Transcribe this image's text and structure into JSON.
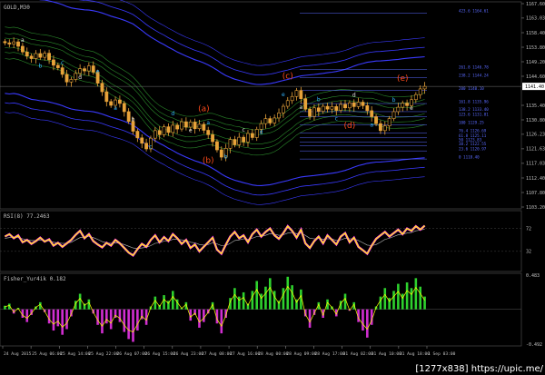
{
  "main_title": "GOLD,M30",
  "rsi_title": "RSI(8) 77.2463",
  "fisher_title": "Fisher_Yur4ik 0.182",
  "watermark": "[1277x838] https://upic.me/",
  "colors": {
    "background": "#000000",
    "candle": "#e8a33a",
    "envelope_blue": "#3a3aff",
    "envelope_green": "#2b8a2b",
    "fib_line": "#5a6aff",
    "wave_red": "#ff4a1a",
    "wave_cyan": "#33b5ff",
    "wave_white": "#e0e0e0",
    "rsi_yellow": "#ffff00",
    "rsi_magenta": "#ff33ff",
    "fisher_green": "#2ed12e",
    "fisher_magenta": "#d12ed1",
    "axis_text": "#c0c0c0"
  },
  "price_axis": {
    "ticks": [
      "1167.60",
      "1163.03",
      "1158.40",
      "1153.80",
      "1149.20",
      "1144.60",
      "1135.40",
      "1130.80",
      "1126.23",
      "1121.63",
      "1117.03",
      "1112.40",
      "1107.80",
      "1103.20"
    ],
    "current": "1141.40"
  },
  "rsi_axis": {
    "ticks": [
      "72",
      "32"
    ]
  },
  "fisher_axis": {
    "ticks": [
      "0.483",
      "-0.492"
    ]
  },
  "time_axis": [
    "24 Aug 2015",
    "25 Aug 06:00",
    "25 Aug 14:00",
    "25 Aug 22:00",
    "26 Aug 07:00",
    "26 Aug 15:00",
    "26 Aug 23:00",
    "27 Aug 08:00",
    "27 Aug 16:00",
    "28 Aug 00:00",
    "28 Aug 09:00",
    "28 Aug 17:00",
    "31 Aug 02:00",
    "31 Aug 10:00",
    "31 Aug 18:00",
    "1 Sep 03:00"
  ],
  "fib_levels": [
    {
      "label": "423.6 1164.61"
    },
    {
      "label": "261.8 1146.78"
    },
    {
      "label": "238.2 1144.24"
    },
    {
      "label": "200 1140.10"
    },
    {
      "label": "161.8 1135.96"
    },
    {
      "label": "138.2 1133.40"
    },
    {
      "label": "123.6 1131.81"
    },
    {
      "label": "100 1129.25"
    },
    {
      "label": "76.4 1126.69"
    },
    {
      "label": "61.8 1125.11"
    },
    {
      "label": "50 1123.83"
    },
    {
      "label": "38.2 1122.55"
    },
    {
      "label": "23.6 1120.97"
    },
    {
      "label": "0 1118.40"
    }
  ],
  "wave_labels_major": [
    "(a)",
    "(b)",
    "(c)",
    "(d)",
    "(e)"
  ],
  "wave_labels_minor": [
    "a",
    "b",
    "c",
    "d",
    "e",
    "a",
    "b",
    "c",
    "d",
    "e",
    "a",
    "b",
    "c",
    "d",
    "e",
    "a",
    "b",
    "c",
    "d",
    "a",
    "b",
    "e"
  ],
  "chart_data": [
    {
      "type": "candlestick",
      "title": "GOLD,M30",
      "ylim": [
        1103.2,
        1167.6
      ],
      "close": [
        1155.2,
        1154.8,
        1155.5,
        1154.1,
        1152.3,
        1151.0,
        1150.2,
        1151.8,
        1150.6,
        1151.9,
        1149.8,
        1148.1,
        1147.3,
        1145.2,
        1142.8,
        1143.6,
        1145.5,
        1147.0,
        1146.3,
        1147.9,
        1145.9,
        1142.4,
        1139.7,
        1136.6,
        1135.4,
        1137.1,
        1136.0,
        1133.4,
        1130.3,
        1127.2,
        1125.1,
        1123.4,
        1121.6,
        1125.0,
        1127.4,
        1126.1,
        1128.6,
        1126.8,
        1129.1,
        1127.9,
        1130.2,
        1128.5,
        1130.1,
        1128.0,
        1129.4,
        1127.5,
        1126.1,
        1123.9,
        1121.3,
        1119.0,
        1121.8,
        1124.6,
        1122.9,
        1125.3,
        1123.8,
        1126.5,
        1125.2,
        1127.8,
        1129.6,
        1131.2,
        1129.8,
        1131.4,
        1133.0,
        1135.1,
        1136.9,
        1138.2,
        1140.1,
        1137.5,
        1134.2,
        1131.9,
        1134.6,
        1133.5,
        1135.1,
        1134.2,
        1135.0,
        1133.8,
        1135.7,
        1134.6,
        1136.2,
        1135.0,
        1136.4,
        1135.3,
        1133.7,
        1131.8,
        1129.6,
        1127.4,
        1128.9,
        1131.2,
        1133.4,
        1134.8,
        1136.1,
        1135.3,
        1137.2,
        1138.8,
        1140.6,
        1141.4
      ]
    },
    {
      "type": "line",
      "title": "RSI(8) 77.2463",
      "ylim": [
        0,
        100
      ],
      "series": [
        {
          "values": [
            58,
            62,
            55,
            60,
            48,
            52,
            45,
            50,
            56,
            49,
            53,
            42,
            47,
            40,
            46,
            52,
            61,
            68,
            55,
            62,
            50,
            44,
            39,
            47,
            42,
            52,
            46,
            38,
            30,
            25,
            36,
            45,
            40,
            52,
            60,
            48,
            57,
            50,
            62,
            55,
            45,
            52,
            38,
            44,
            32,
            40,
            48,
            56,
            35,
            28,
            44,
            58,
            66,
            55,
            60,
            48,
            62,
            70,
            58,
            66,
            72,
            60,
            54,
            64,
            76,
            68,
            56,
            70,
            46,
            38,
            50,
            58,
            46,
            60,
            52,
            44,
            58,
            64,
            48,
            56,
            40,
            34,
            28,
            42,
            54,
            60,
            66,
            58,
            64,
            70,
            62,
            72,
            68,
            76,
            70,
            77
          ]
        },
        {
          "values": [
            55,
            56,
            57,
            56,
            54,
            52,
            51,
            51,
            52,
            51,
            50,
            48,
            47,
            46,
            46,
            48,
            52,
            56,
            57,
            58,
            56,
            53,
            49,
            47,
            46,
            47,
            46,
            44,
            41,
            38,
            37,
            38,
            39,
            42,
            46,
            47,
            50,
            50,
            53,
            53,
            52,
            51,
            48,
            47,
            44,
            43,
            44,
            47,
            45,
            42,
            42,
            46,
            51,
            52,
            54,
            53,
            55,
            58,
            58,
            60,
            63,
            62,
            60,
            61,
            64,
            65,
            63,
            64,
            60,
            55,
            54,
            55,
            53,
            54,
            54,
            51,
            52,
            55,
            54,
            54,
            51,
            47,
            43,
            42,
            44,
            48,
            53,
            55,
            58,
            61,
            62,
            64,
            65,
            68,
            69,
            71
          ]
        }
      ]
    },
    {
      "type": "bar",
      "title": "Fisher_Yur4ik 0.182",
      "ylim": [
        -0.492,
        0.483
      ],
      "values": [
        0.05,
        0.08,
        -0.06,
        0.02,
        -0.12,
        -0.18,
        -0.08,
        0.04,
        0.1,
        -0.04,
        -0.2,
        -0.3,
        -0.24,
        -0.36,
        -0.28,
        -0.1,
        0.12,
        0.22,
        0.08,
        0.14,
        -0.06,
        -0.22,
        -0.34,
        -0.2,
        -0.28,
        -0.12,
        -0.18,
        -0.32,
        -0.42,
        -0.46,
        -0.3,
        -0.14,
        -0.22,
        0.04,
        0.18,
        0.06,
        0.2,
        0.12,
        0.26,
        0.14,
        0.02,
        0.1,
        -0.16,
        -0.08,
        -0.26,
        -0.18,
        -0.06,
        0.1,
        -0.2,
        -0.34,
        -0.12,
        0.16,
        0.3,
        0.18,
        0.24,
        0.08,
        0.26,
        0.4,
        0.22,
        0.32,
        0.44,
        0.26,
        0.12,
        0.3,
        0.46,
        0.34,
        0.14,
        0.28,
        -0.1,
        -0.26,
        -0.08,
        0.1,
        -0.12,
        0.14,
        0.04,
        -0.1,
        0.12,
        0.22,
        -0.02,
        0.1,
        -0.18,
        -0.3,
        -0.4,
        -0.22,
        0.04,
        0.18,
        0.3,
        0.16,
        0.26,
        0.36,
        0.22,
        0.38,
        0.3,
        0.44,
        0.32,
        0.18
      ]
    }
  ]
}
